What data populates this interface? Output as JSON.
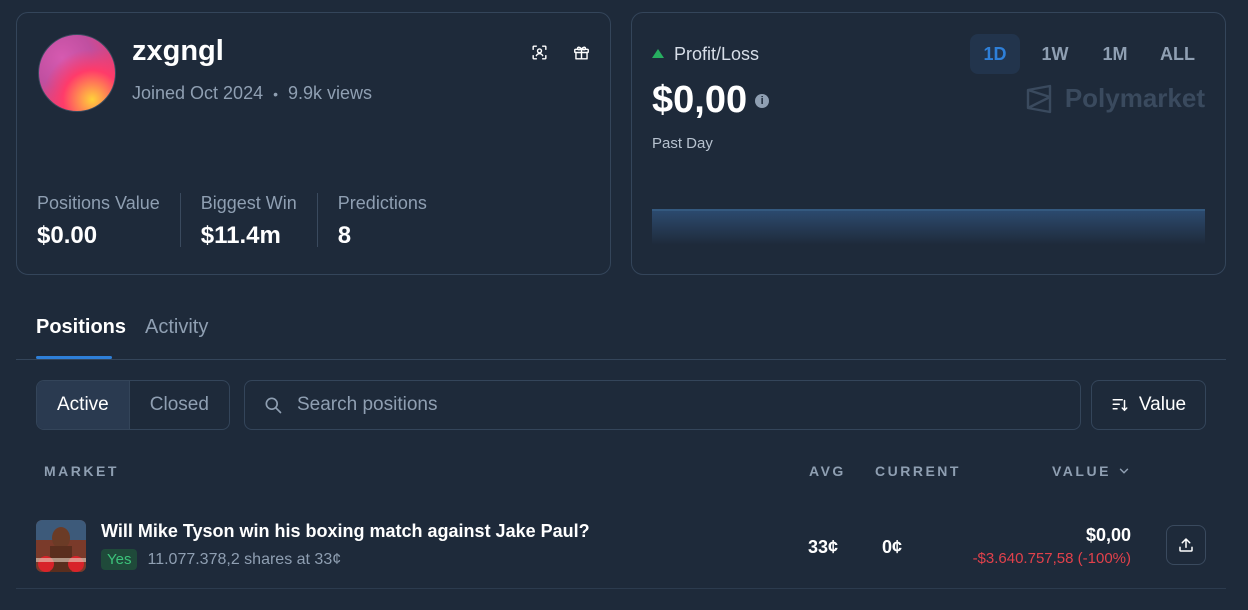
{
  "profile": {
    "username": "zxgngl",
    "joined": "Joined Oct 2024",
    "dot": "•",
    "views": "9.9k views",
    "icons": [
      "scan-icon",
      "gift-icon"
    ],
    "stats": [
      {
        "label": "Positions Value",
        "value": "$0.00"
      },
      {
        "label": "Biggest Win",
        "value": "$11.4m"
      },
      {
        "label": "Predictions",
        "value": "8"
      }
    ]
  },
  "pnl": {
    "label": "Profit/Loss",
    "value": "$0,00",
    "period": "Past Day",
    "ranges": [
      "1D",
      "1W",
      "1M",
      "ALL"
    ],
    "active_range": "1D",
    "brand": "Polymarket",
    "up_color": "#27ae60"
  },
  "tabs": [
    "Positions",
    "Activity"
  ],
  "filters": {
    "active": "Active",
    "closed": "Closed",
    "search_placeholder": "Search positions",
    "sort_label": "Value"
  },
  "table": {
    "headers": {
      "market": "MARKET",
      "avg": "AVG",
      "current": "CURRENT",
      "value": "VALUE"
    },
    "rows": [
      {
        "title": "Will Mike Tyson win his boxing match against Jake Paul?",
        "outcome": "Yes",
        "shares": "11.077.378,2 shares at 33¢",
        "avg": "33¢",
        "current": "0¢",
        "value": "$0,00",
        "change": "-$3.640.757,58 (-100%)"
      }
    ]
  },
  "colors": {
    "accent": "#2e7fd8",
    "negative": "#e2414b",
    "positive": "#3cc27a",
    "background": "#1e2a3a"
  }
}
